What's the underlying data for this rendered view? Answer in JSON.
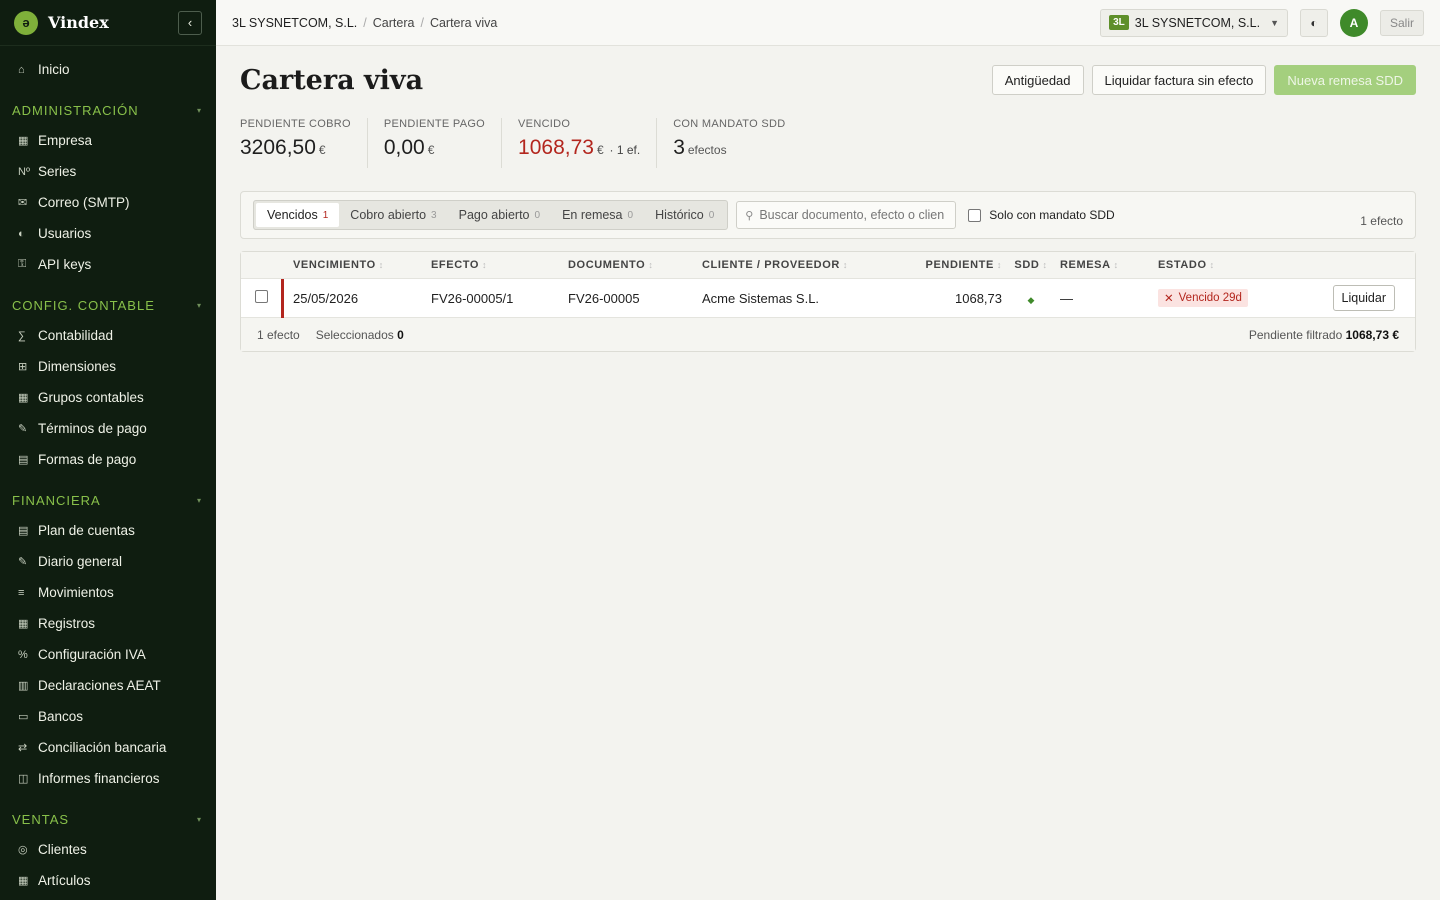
{
  "brand": {
    "logo": "ә",
    "name": "Vindex",
    "collapse_icon": "chevron-left"
  },
  "sidebar": {
    "home": {
      "icon": "⌂",
      "label": "Inicio"
    },
    "sections": [
      {
        "title": "ADMINISTRACIÓN",
        "items": [
          {
            "icon": "▦",
            "label": "Empresa"
          },
          {
            "icon": "Nº",
            "label": "Series"
          },
          {
            "icon": "✉",
            "label": "Correo (SMTP)"
          },
          {
            "icon": "◐",
            "label": "Usuarios"
          },
          {
            "icon": "⚿",
            "label": "API keys"
          }
        ]
      },
      {
        "title": "CONFIG. CONTABLE",
        "items": [
          {
            "icon": "∑",
            "label": "Contabilidad"
          },
          {
            "icon": "⊞",
            "label": "Dimensiones"
          },
          {
            "icon": "▦",
            "label": "Grupos contables"
          },
          {
            "icon": "✎",
            "label": "Términos de pago"
          },
          {
            "icon": "▤",
            "label": "Formas de pago"
          }
        ]
      },
      {
        "title": "FINANCIERA",
        "items": [
          {
            "icon": "▤",
            "label": "Plan de cuentas"
          },
          {
            "icon": "✎",
            "label": "Diario general"
          },
          {
            "icon": "≡",
            "label": "Movimientos"
          },
          {
            "icon": "▦",
            "label": "Registros"
          },
          {
            "icon": "%",
            "label": "Configuración IVA"
          },
          {
            "icon": "▥",
            "label": "Declaraciones AEAT"
          },
          {
            "icon": "▭",
            "label": "Bancos"
          },
          {
            "icon": "⇄",
            "label": "Conciliación bancaria"
          },
          {
            "icon": "◫",
            "label": "Informes financieros"
          }
        ]
      },
      {
        "title": "VENTAS",
        "items": [
          {
            "icon": "◎",
            "label": "Clientes"
          },
          {
            "icon": "▦",
            "label": "Artículos"
          }
        ]
      }
    ]
  },
  "topbar": {
    "breadcrumb": [
      "3L SYSNETCOM, S.L.",
      "Cartera",
      "Cartera viva"
    ],
    "company_badge": "3L",
    "company_name": "3L SYSNETCOM, S.L.",
    "avatar": "A",
    "logout": "Salir"
  },
  "page": {
    "title": "Cartera viva",
    "actions": {
      "aging": "Antigüedad",
      "settle": "Liquidar factura sin efecto",
      "new_remittance": "Nueva remesa SDD"
    }
  },
  "kpis": [
    {
      "label": "PENDIENTE COBRO",
      "value": "3206,50",
      "unit": "€",
      "extra": ""
    },
    {
      "label": "PENDIENTE PAGO",
      "value": "0,00",
      "unit": "€",
      "extra": ""
    },
    {
      "label": "VENCIDO",
      "value": "1068,73",
      "unit": "€",
      "extra": "· 1 ef."
    },
    {
      "label": "CON MANDATO SDD",
      "value": "3",
      "unit": "efectos",
      "extra": ""
    }
  ],
  "filters": {
    "tabs": [
      {
        "label": "Vencidos",
        "count": "1"
      },
      {
        "label": "Cobro abierto",
        "count": "3"
      },
      {
        "label": "Pago abierto",
        "count": "0"
      },
      {
        "label": "En remesa",
        "count": "0"
      },
      {
        "label": "Histórico",
        "count": "0"
      }
    ],
    "search_placeholder": "Buscar documento, efecto o cliente",
    "sdd_only": "Solo con mandato SDD",
    "count_label": "1 efecto"
  },
  "table": {
    "columns": [
      "VENCIMIENTO",
      "EFECTO",
      "DOCUMENTO",
      "CLIENTE / PROVEEDOR",
      "PENDIENTE",
      "SDD",
      "REMESA",
      "ESTADO"
    ],
    "rows": [
      {
        "vencimiento": "25/05/2026",
        "efecto": "FV26-00005/1",
        "documento": "FV26-00005",
        "cliente": "Acme Sistemas S.L.",
        "pendiente": "1068,73",
        "sdd": "◆",
        "remesa": "—",
        "estado": "Vencido 29d",
        "action": "Liquidar"
      }
    ],
    "footer": {
      "count": "1 efecto",
      "selected_label": "Seleccionados",
      "selected_value": "0",
      "pending_label": "Pendiente filtrado",
      "pending_value": "1068,73 €"
    }
  },
  "colors": {
    "sidebar_bg": "#0f1d10",
    "accent_green": "#88c04a",
    "overdue_red": "#b3261e",
    "primary_btn": "#a4cf7e"
  }
}
